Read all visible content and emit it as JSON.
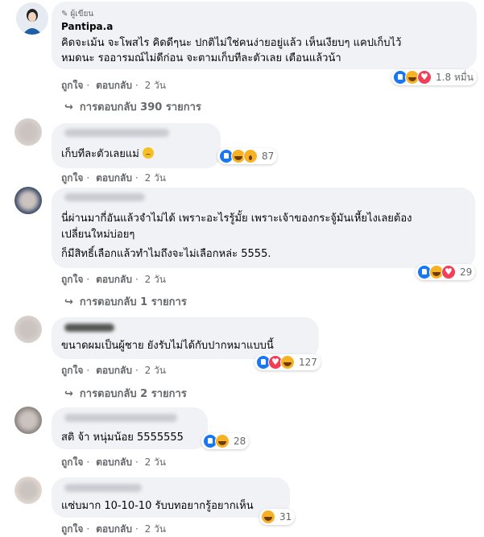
{
  "post_author": {
    "label": "ผู้เขียน",
    "name": "Pantipa.a",
    "lines": [
      "คิดจะเม้น จะโพสไร คิดดีๆนะ ปกติไม่ใช่คนง่ายอยู่แล้ว เห็นเงียบๆ แคปเก็บไว้",
      "หมดนะ รออารมณ์ไม่ดีก่อน จะตามเก็บทีละตัวเลย เตือนแล้วน้า"
    ],
    "actions": [
      "ถูกใจ",
      "ตอบกลับ",
      "2 วัน"
    ],
    "reactions": [
      "like-icon",
      "haha-icon",
      "love-icon"
    ],
    "reaction_count": "1.8 หมื่น",
    "replies": "การตอบกลับ 390 รายการ"
  },
  "comments": [
    {
      "lines": [
        "เก็บทีละตัวเลยแม่"
      ],
      "emoji": "sad-face-icon",
      "actions": [
        "ถูกใจ",
        "ตอบกลับ",
        "2 วัน"
      ],
      "reactions": [
        "like-icon",
        "haha-icon",
        "wow-icon"
      ],
      "reaction_count": "87"
    },
    {
      "lines": [
        "นี่ผ่านมากี่อันแล้วจำไม่ได้ เพราะอะไรรู้มั้ย เพราะเจ้าของกระจู้มันเหี้ยไงเลยต้อง",
        "เปลี่ยนใหม่บ่อยๆ",
        "ก็มีสิทธิ์เลือกแล้วทำไมถึงจะไม่เลือกหล่ะ 5555."
      ],
      "actions": [
        "ถูกใจ",
        "ตอบกลับ",
        "2 วัน"
      ],
      "reactions": [
        "like-icon",
        "haha-icon",
        "love-icon"
      ],
      "reaction_count": "29",
      "replies": "การตอบกลับ 1 รายการ"
    },
    {
      "lines": [
        "ขนาดผมเป็นผู้ชาย ยังรับไม่ได้กับปากหมาแบบนี้"
      ],
      "actions": [
        "ถูกใจ",
        "ตอบกลับ",
        "2 วัน"
      ],
      "reactions": [
        "like-icon",
        "love-icon",
        "haha-icon"
      ],
      "reaction_count": "127",
      "replies": "การตอบกลับ 2 รายการ"
    },
    {
      "lines": [
        "สติ จ้า หนุ่มน้อย 5555555"
      ],
      "actions": [
        "ถูกใจ",
        "ตอบกลับ",
        "2 วัน"
      ],
      "reactions": [
        "like-icon",
        "haha-icon"
      ],
      "reaction_count": "28"
    },
    {
      "lines": [
        "แซ่บมาก 10-10-10 รับบทอยากรู้อยากเห็น"
      ],
      "actions": [
        "ถูกใจ",
        "ตอบกลับ",
        "2 วัน"
      ],
      "reactions": [
        "haha-icon"
      ],
      "reaction_count": "31"
    }
  ]
}
